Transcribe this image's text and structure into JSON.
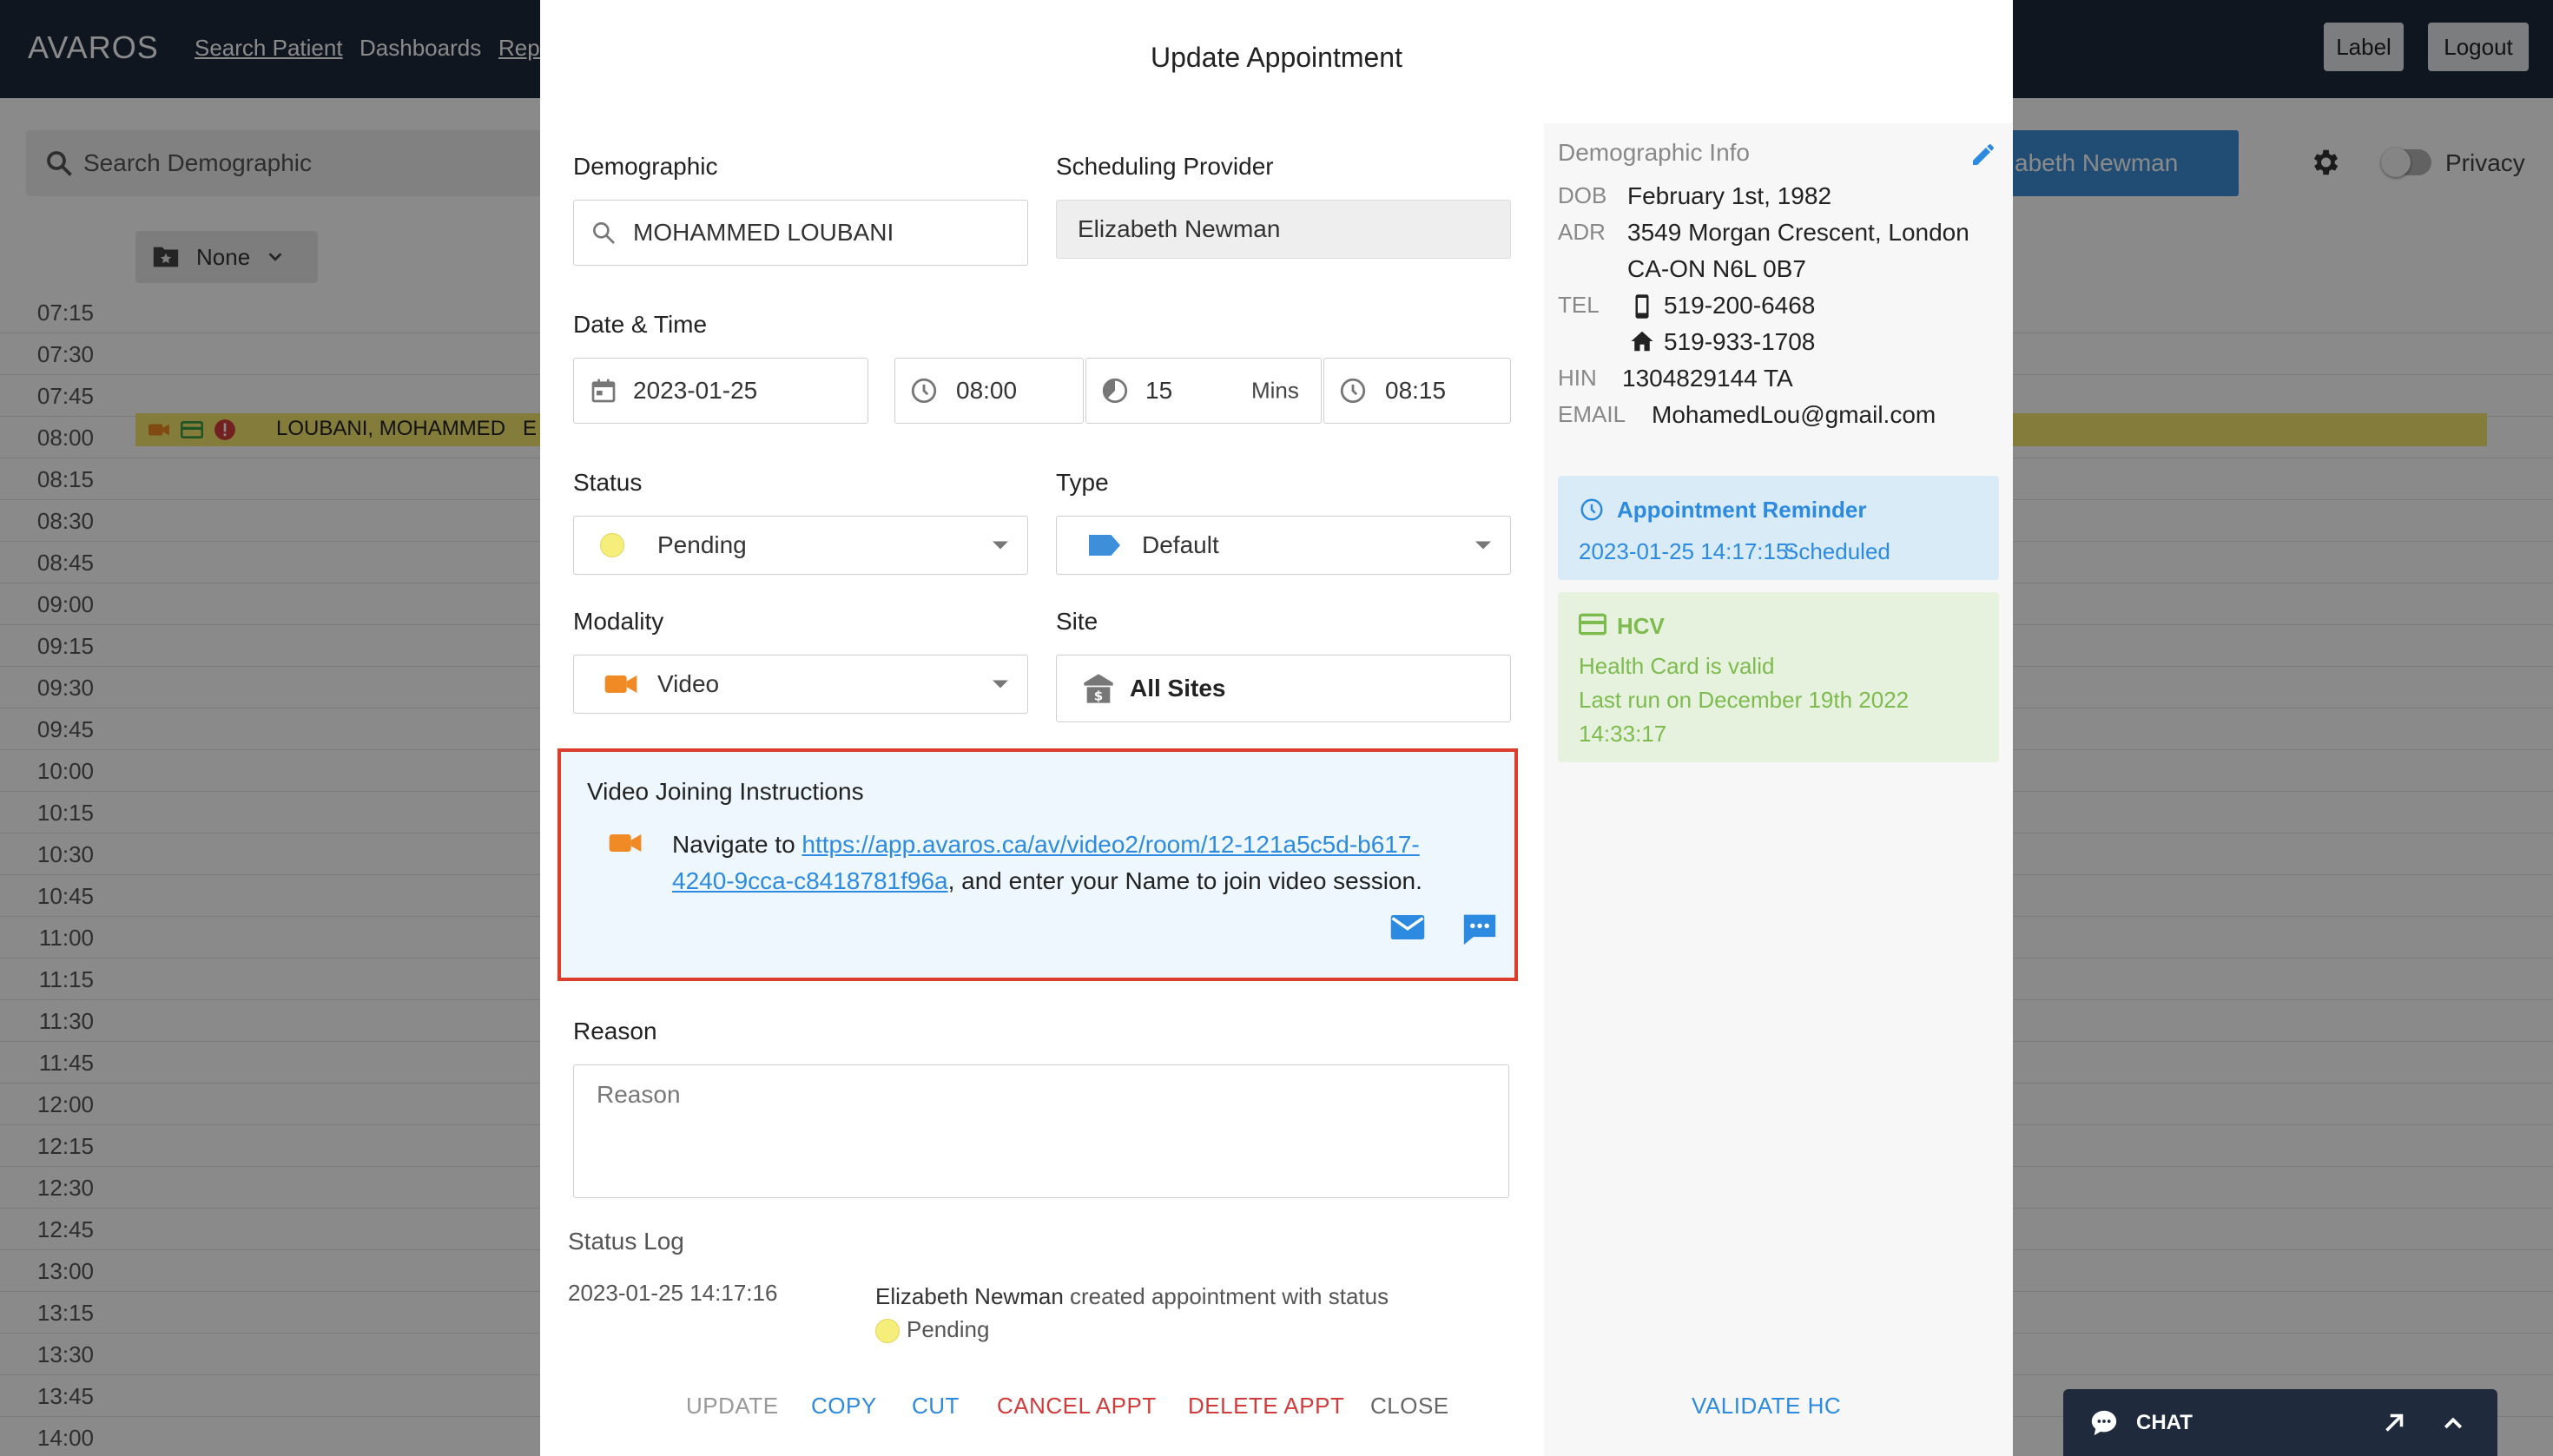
{
  "app": {
    "logo": "AVAROS",
    "nav": {
      "search_patient": "Search Patient",
      "dashboards": "Dashboards",
      "reports_partial": "Repo"
    },
    "label_button": "Label",
    "logout_button": "Logout",
    "search_placeholder": "Search Demographic",
    "provider_button": "abeth Newman",
    "privacy_label": "Privacy",
    "filter_label": "None",
    "times": [
      "07:15",
      "07:30",
      "07:45",
      "08:00",
      "08:15",
      "08:30",
      "08:45",
      "09:00",
      "09:15",
      "09:30",
      "09:45",
      "10:00",
      "10:15",
      "10:30",
      "10:45",
      "11:00",
      "11:15",
      "11:30",
      "11:45",
      "12:00",
      "12:15",
      "12:30",
      "12:45",
      "13:00",
      "13:15",
      "13:30",
      "13:45",
      "14:00"
    ],
    "appointment_name": "LOUBANI, MOHAMMED",
    "appointment_extra": "E"
  },
  "chat": {
    "label": "CHAT"
  },
  "modal": {
    "title": "Update Appointment",
    "demographic": {
      "label": "Demographic",
      "value": "MOHAMMED LOUBANI"
    },
    "scheduling_provider": {
      "label": "Scheduling Provider",
      "value": "Elizabeth Newman"
    },
    "date_time": {
      "label": "Date & Time",
      "date": "2023-01-25",
      "start": "08:00",
      "duration": "15",
      "duration_unit": "Mins",
      "end": "08:15"
    },
    "status": {
      "label": "Status",
      "value": "Pending"
    },
    "type": {
      "label": "Type",
      "value": "Default"
    },
    "modality": {
      "label": "Modality",
      "value": "Video"
    },
    "site": {
      "label": "Site",
      "value": "All Sites"
    },
    "video_instructions": {
      "title": "Video Joining Instructions",
      "prefix": "Navigate to ",
      "link": "https://app.avaros.ca/av/video2/room/12-121a5c5d-b617-4240-9cca-c8418781f96a",
      "suffix": ", and enter your Name to join video session."
    },
    "reason": {
      "label": "Reason",
      "placeholder": "Reason"
    },
    "status_log": {
      "title": "Status Log",
      "entries": [
        {
          "time": "2023-01-25 14:17:16",
          "user": "Elizabeth Newman",
          "action": " created appointment with status",
          "status": "Pending"
        }
      ]
    },
    "actions": {
      "update": "UPDATE",
      "copy": "COPY",
      "cut": "CUT",
      "cancel": "CANCEL APPT",
      "delete": "DELETE APPT",
      "close": "CLOSE"
    },
    "demographic_info": {
      "title": "Demographic Info",
      "dob_label": "DOB",
      "dob": "February 1st, 1982",
      "adr_label": "ADR",
      "adr_line1": "3549 Morgan Crescent, London",
      "adr_line2": "CA-ON N6L 0B7",
      "tel_label": "TEL",
      "tel_mobile": "519-200-6468",
      "tel_home": "519-933-1708",
      "hin_label": "HIN",
      "hin": "1304829144 TA",
      "email_label": "EMAIL",
      "email": "MohamedLou@gmail.com"
    },
    "reminder": {
      "title": "Appointment Reminder",
      "time": "2023-01-25 14:17:15:",
      "status": "Scheduled"
    },
    "hcv": {
      "title": "HCV",
      "line1": "Health Card is valid",
      "line2": "Last run on December 19th 2022",
      "line3": "14:33:17"
    },
    "validate_button": "VALIDATE HC"
  },
  "colors": {
    "topbar": "#1f2a3c",
    "primary_blue": "#2c8be0",
    "danger_red": "#d23b3b",
    "highlight_border": "#dd3e2c",
    "pending_yellow": "#f6ee7a",
    "video_orange": "#f08a24",
    "hcv_green": "#7dbb4f"
  }
}
